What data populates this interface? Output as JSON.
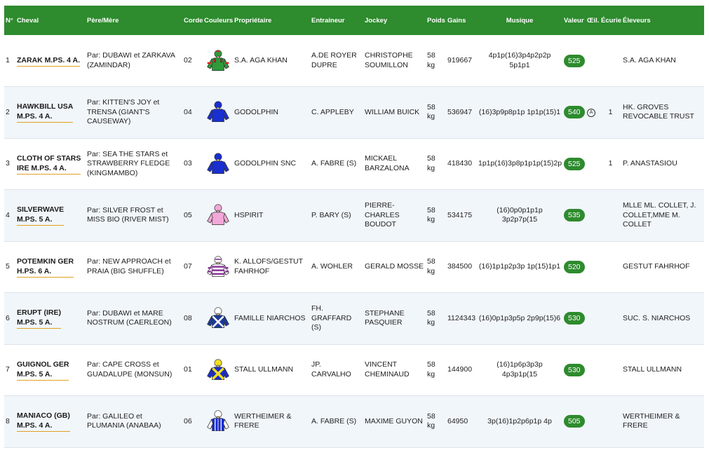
{
  "headers": {
    "num": "N°",
    "horse": "Cheval",
    "parents": "Père/Mère",
    "corde": "Corde",
    "couleurs": "Couleurs",
    "proprietaire": "Propriétaire",
    "entraineur": "Entraineur",
    "jockey": "Jockey",
    "poids": "Poids",
    "gains": "Gains",
    "musique": "Musique",
    "valeur": "Valeur",
    "oeil": "Œil.",
    "ecurie": "Écurie.",
    "eleveurs": "Éleveurs"
  },
  "rows": [
    {
      "num": "1",
      "horse1": "ZARAK M.PS. 4 A.",
      "horse2": "",
      "parents": "Par: DUBAWI et ZARKAVA (ZAMINDAR)",
      "corde": "02",
      "silk": "green-red-cap",
      "proprietaire": "S.A. AGA KHAN",
      "entraineur": "A.DE ROYER DUPRE",
      "jockey": "CHRISTOPHE SOUMILLON",
      "poids": "58 kg",
      "gains": "919667",
      "musique": "4p1p(16)3p4p2p2p 5p1p1",
      "valeur": "525",
      "oeil": "",
      "ecurie": "",
      "eleveurs": "S.A. AGA KHAN"
    },
    {
      "num": "2",
      "horse1": "HAWKBILL USA",
      "horse2": "M.PS. 4 A.",
      "parents": "Par: KITTEN'S JOY et TRENSA (GIANT'S CAUSEWAY)",
      "corde": "04",
      "silk": "royal-blue",
      "proprietaire": "GODOLPHIN",
      "entraineur": "C. APPLEBY",
      "jockey": "WILLIAM BUICK",
      "poids": "58 kg",
      "gains": "536947",
      "musique": "(16)3p9p8p1p 1p1p(15)1",
      "valeur": "540",
      "oeil": "A",
      "ecurie": "1",
      "eleveurs": "HK. GROVES REVOCABLE TRUST"
    },
    {
      "num": "3",
      "horse1": "CLOTH OF STARS",
      "horse2": "IRE M.PS. 4 A.",
      "parents": "Par: SEA THE STARS et STRAWBERRY FLEDGE (KINGMAMBO)",
      "corde": "03",
      "silk": "royal-blue",
      "proprietaire": "GODOLPHIN SNC",
      "entraineur": "A. FABRE (S)",
      "jockey": "MICKAEL BARZALONA",
      "poids": "58 kg",
      "gains": "418430",
      "musique": "1p1p(16)3p8p1p1p(15)2p",
      "valeur": "525",
      "oeil": "",
      "ecurie": "1",
      "eleveurs": "P. ANASTASIOU"
    },
    {
      "num": "4",
      "horse1": "SILVERWAVE",
      "horse2": "M.PS. 5 A.",
      "parents": "Par: SILVER FROST et MISS BIO (RIVER MIST)",
      "corde": "05",
      "silk": "pink",
      "proprietaire": "HSPIRIT",
      "entraineur": "P. BARY (S)",
      "jockey": "PIERRE-CHARLES BOUDOT",
      "poids": "58 kg",
      "gains": "534175",
      "musique": "(16)0p0p1p1p 3p2p7p(15",
      "valeur": "535",
      "oeil": "",
      "ecurie": "",
      "eleveurs": "MLLE ML. COLLET, J. COLLET,MME M. COLLET"
    },
    {
      "num": "5",
      "horse1": "POTEMKIN GER",
      "horse2": "H.PS. 6 A.",
      "parents": "Par: NEW APPROACH et PRAIA (BIG SHUFFLE)",
      "corde": "07",
      "silk": "purple-white-hoops",
      "proprietaire": "K. ALLOFS/GESTUT FAHRHOF",
      "entraineur": "A. WOHLER",
      "jockey": "GERALD MOSSE",
      "poids": "58 kg",
      "gains": "384500",
      "musique": "(16)1p1p2p3p 1p(15)1p1",
      "valeur": "520",
      "oeil": "",
      "ecurie": "",
      "eleveurs": "GESTUT FAHRHOF"
    },
    {
      "num": "6",
      "horse1": "ERUPT (IRE)",
      "horse2": "M.PS. 5 A.",
      "parents": "Par: DUBAWI et MARE NOSTRUM (CAERLEON)",
      "corde": "08",
      "silk": "blue-white-cross",
      "proprietaire": "FAMILLE NIARCHOS",
      "entraineur": "FH. GRAFFARD (S)",
      "jockey": "STEPHANE PASQUIER",
      "poids": "58 kg",
      "gains": "1124343",
      "musique": "(16)0p1p3p5p 2p9p(15)6",
      "valeur": "530",
      "oeil": "",
      "ecurie": "",
      "eleveurs": "SUC. S. NIARCHOS"
    },
    {
      "num": "7",
      "horse1": "GUIGNOL GER",
      "horse2": "M.PS. 5 A.",
      "parents": "Par: CAPE CROSS et GUADALUPE (MONSUN)",
      "corde": "01",
      "silk": "blue-yellow-cross",
      "proprietaire": "STALL ULLMANN",
      "entraineur": "JP. CARVALHO",
      "jockey": "VINCENT CHEMINAUD",
      "poids": "58 kg",
      "gains": "144900",
      "musique": "(16)1p6p3p3p 4p3p1p(15",
      "valeur": "530",
      "oeil": "",
      "ecurie": "",
      "eleveurs": "STALL ULLMANN"
    },
    {
      "num": "8",
      "horse1": "MANIACO (GB)",
      "horse2": "M.PS. 4 A.",
      "parents": "Par: GALILEO et PLUMANIA (ANABAA)",
      "corde": "06",
      "silk": "blue-white-seams",
      "proprietaire": "WERTHEIMER & FRERE",
      "entraineur": "A. FABRE (S)",
      "jockey": "MAXIME GUYON",
      "poids": "58 kg",
      "gains": "64950",
      "musique": "3p(16)1p2p6p1p 4p",
      "valeur": "505",
      "oeil": "",
      "ecurie": "",
      "eleveurs": "WERTHEIMER & FRERE"
    }
  ],
  "colors": {
    "header": "#2e8b2e",
    "underline": "#e0a020",
    "row_alt": "#f1f6fb"
  }
}
